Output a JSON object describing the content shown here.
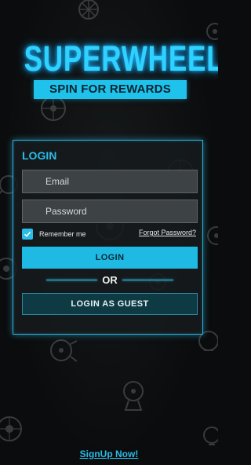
{
  "brand": {
    "title": "SUPERWHEELS",
    "subtitle": "SPIN FOR REWARDS"
  },
  "login_panel": {
    "title": "LOGIN",
    "email_placeholder": "Email",
    "password_placeholder": "Password",
    "remember_label": "Remember me",
    "remember_checked": true,
    "forgot_label": "Forgot Password?",
    "login_button": "LOGIN",
    "divider_text": "OR",
    "guest_button": "LOGIN AS GUEST"
  },
  "footer": {
    "signup_link": "SignUp Now!"
  },
  "colors": {
    "accent": "#1ebae3",
    "background": "#0b0c0d",
    "panel_border": "#2bb0d8",
    "guest_button_bg": "#0e3a44"
  },
  "background_icons": [
    "wheel-icon",
    "wheel-stand-icon",
    "wheel-rotate-icon"
  ]
}
